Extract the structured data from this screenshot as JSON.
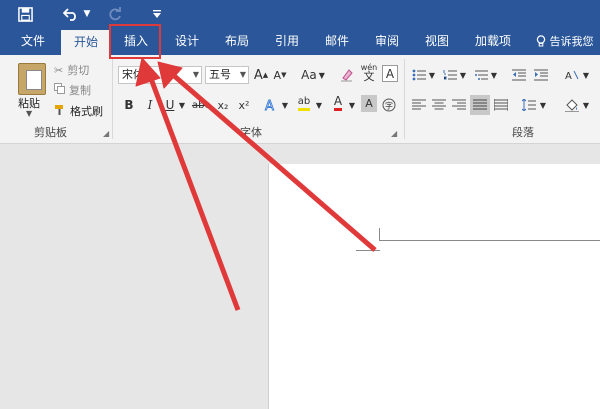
{
  "quick_access": {
    "save_icon": "save-icon",
    "undo_icon": "undo-icon",
    "redo_icon": "redo-icon",
    "customize_icon": "customize-caret"
  },
  "tabs": [
    {
      "label": "文件"
    },
    {
      "label": "开始"
    },
    {
      "label": "插入"
    },
    {
      "label": "设计"
    },
    {
      "label": "布局"
    },
    {
      "label": "引用"
    },
    {
      "label": "邮件"
    },
    {
      "label": "审阅"
    },
    {
      "label": "视图"
    },
    {
      "label": "加载项"
    }
  ],
  "active_tab": "开始",
  "tell_me": "告诉我您",
  "clipboard": {
    "paste_label": "粘贴",
    "cut_label": "剪切",
    "copy_label": "复制",
    "format_painter_label": "格式刷",
    "group_label": "剪贴板"
  },
  "font": {
    "font_name": "宋体",
    "font_size": "五号",
    "group_label": "字体",
    "wen_label": "wén",
    "wen_char": "文",
    "a_char": "A",
    "aa_label": "Aa",
    "bold": "B",
    "italic": "I",
    "underline": "U",
    "strike": "abc",
    "sub": "x₂",
    "sup": "x²"
  },
  "paragraph": {
    "group_label": "段落"
  },
  "colors": {
    "ribbon_blue": "#2b579a",
    "annotation_red": "#e0393a"
  }
}
